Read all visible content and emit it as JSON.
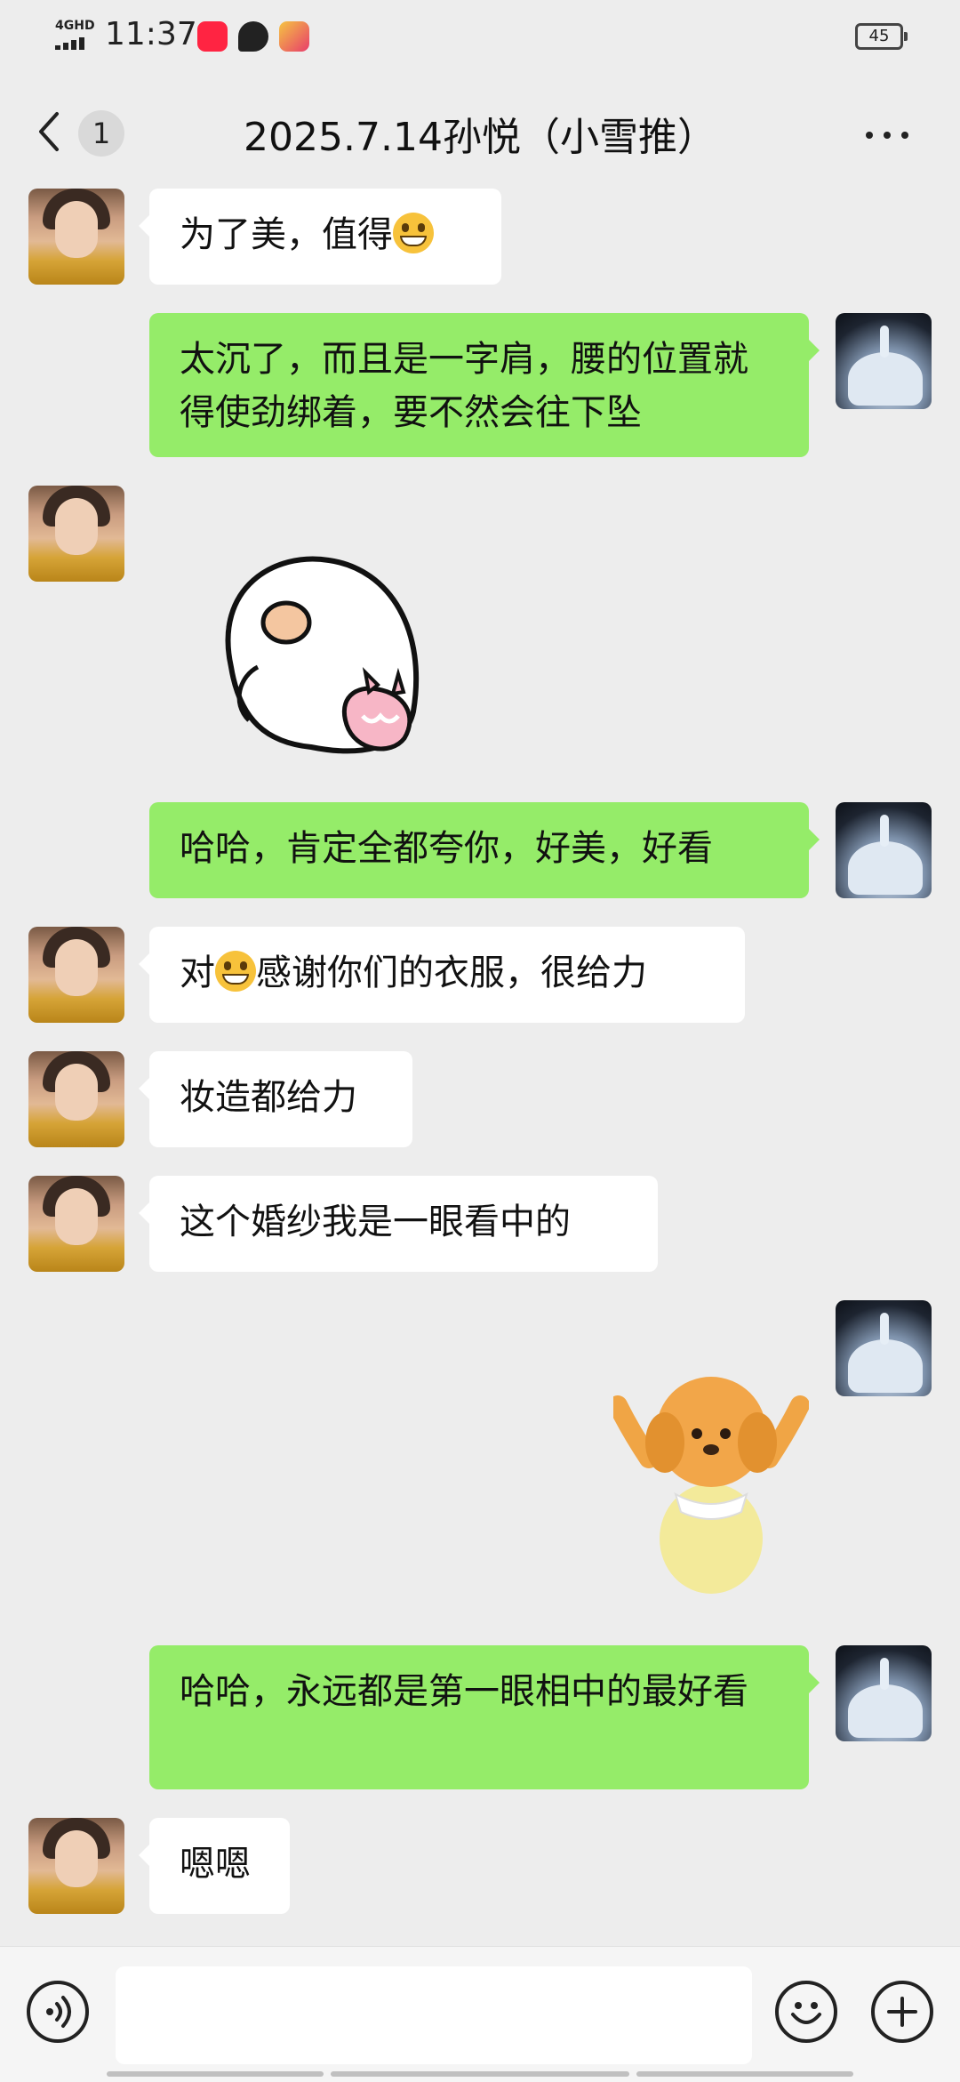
{
  "status_bar": {
    "network": "4GHD",
    "time": "11:37",
    "battery": "45"
  },
  "header": {
    "back_count": "1",
    "title": "2025.7.14孙悦（小雪推）"
  },
  "messages": [
    {
      "from": "contact",
      "text_before": "为了美，值得",
      "emoji": "grinning-face",
      "text_after": ""
    },
    {
      "from": "self",
      "text": "太沉了，而且是一字肩，腰的位置就得使劲绑着，要不然会往下坠"
    },
    {
      "from": "contact",
      "sticker": "white-blob-with-pink-bunny"
    },
    {
      "from": "self",
      "text": "哈哈，肯定全都夸你，好美，好看"
    },
    {
      "from": "contact",
      "text_before": "对",
      "emoji": "grinning-face",
      "text_after": "感谢你们的衣服，很给力"
    },
    {
      "from": "contact",
      "text": "妆造都给力"
    },
    {
      "from": "contact",
      "text": "这个婚纱我是一眼看中的"
    },
    {
      "from": "self",
      "sticker": "fluffy-puppy-waving"
    },
    {
      "from": "self",
      "text": "哈哈，永远都是第一眼相中的最好看"
    },
    {
      "from": "contact",
      "text": "嗯嗯"
    }
  ],
  "colors": {
    "background": "#ededed",
    "incoming_bubble": "#ffffff",
    "outgoing_bubble": "#95ec69"
  },
  "input_bar": {
    "voice_icon": "voice-icon",
    "emoji_icon": "emoji-icon",
    "plus_icon": "plus-icon"
  }
}
